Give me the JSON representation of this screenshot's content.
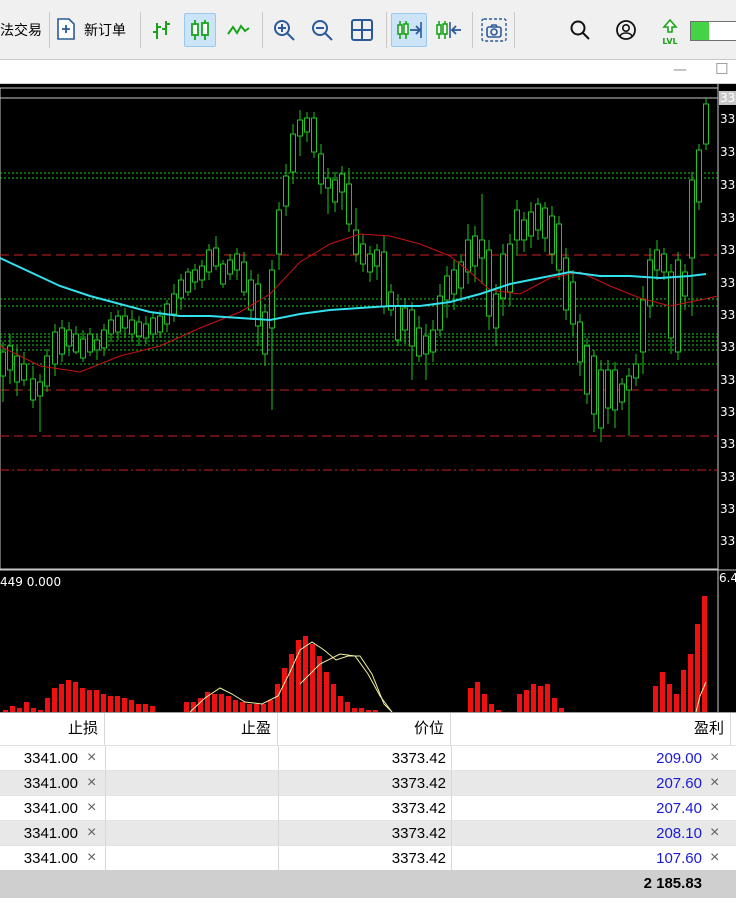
{
  "toolbar": {
    "algo_label": "法交易",
    "new_order_label": "新订单",
    "lvl_label": "LVL",
    "buttons": [
      "bar-chart-icon",
      "candlestick-icon",
      "line-chart-icon",
      "zoom-in-icon",
      "zoom-out-icon",
      "grid-icon",
      "autoscroll-icon",
      "chart-shift-icon",
      "screenshot-icon",
      "search-icon",
      "account-icon",
      "signal-icon"
    ]
  },
  "window": {
    "minimize_glyph": "—",
    "maximize_glyph": "☐"
  },
  "chart": {
    "price_axis_label_fragment": "33",
    "indicator_label": "449 0.000",
    "indicator_axis_label": "6.4",
    "colors": {
      "background": "#000000",
      "candle_up": "#ffffff",
      "candle_down": "#000000",
      "wick": "#21c521",
      "ma_fast": "#cc1111",
      "ma_slow": "#33e0ee",
      "volume_bar": "#ee1111",
      "signal_line": "#f0f0a0",
      "stop_loss_line": "#cc2222",
      "order_line": "#22cc22"
    }
  },
  "table": {
    "headers": {
      "sl": "止损",
      "tp": "止盈",
      "price": "价位",
      "profit": "盈利"
    },
    "close_glyph": "×",
    "rows": [
      {
        "sl": "3341.00",
        "tp": "",
        "price": "3373.42",
        "profit": "209.00"
      },
      {
        "sl": "3341.00",
        "tp": "",
        "price": "3373.42",
        "profit": "207.60"
      },
      {
        "sl": "3341.00",
        "tp": "",
        "price": "3373.42",
        "profit": "207.40"
      },
      {
        "sl": "3341.00",
        "tp": "",
        "price": "3373.42",
        "profit": "208.10"
      },
      {
        "sl": "3341.00",
        "tp": "",
        "price": "3373.42",
        "profit": "107.60"
      }
    ],
    "total_profit": "2 185.83"
  }
}
